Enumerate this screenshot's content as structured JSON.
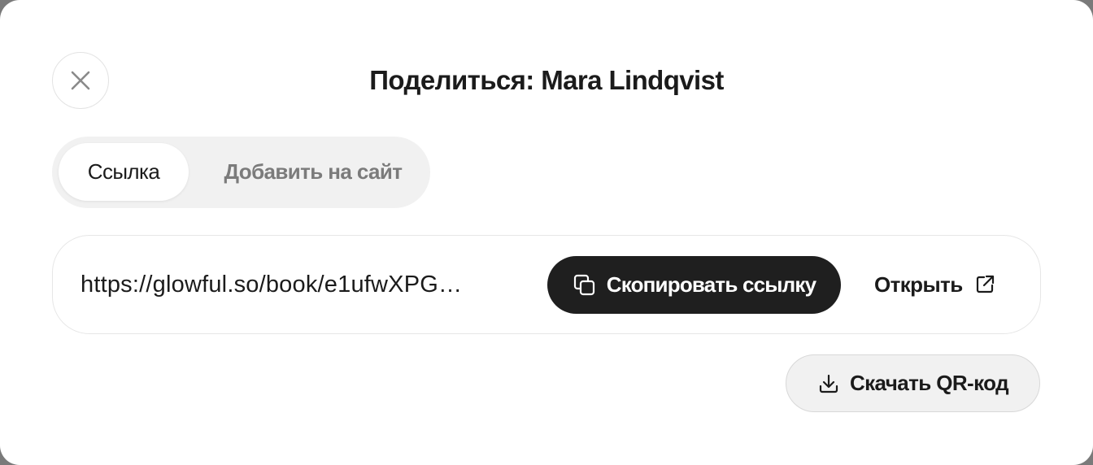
{
  "dialog": {
    "title": "Поделиться: Mara Lindqvist",
    "close_icon": "close-icon"
  },
  "tabs": [
    {
      "label": "Ссылка",
      "active": true
    },
    {
      "label": "Добавить на сайт",
      "active": false
    }
  ],
  "link": {
    "url": "https://glowful.so/book/e1ufwXPG…",
    "copy_label": "Скопировать ссылку",
    "copy_icon": "copy-icon",
    "open_label": "Открыть",
    "open_icon": "external-link-icon"
  },
  "qr": {
    "label": "Скачать QR-код",
    "icon": "download-icon"
  },
  "colors": {
    "primary_dark": "#1f1f1f",
    "tab_track": "#f1f1f1",
    "muted_text": "#7b7b7b"
  }
}
